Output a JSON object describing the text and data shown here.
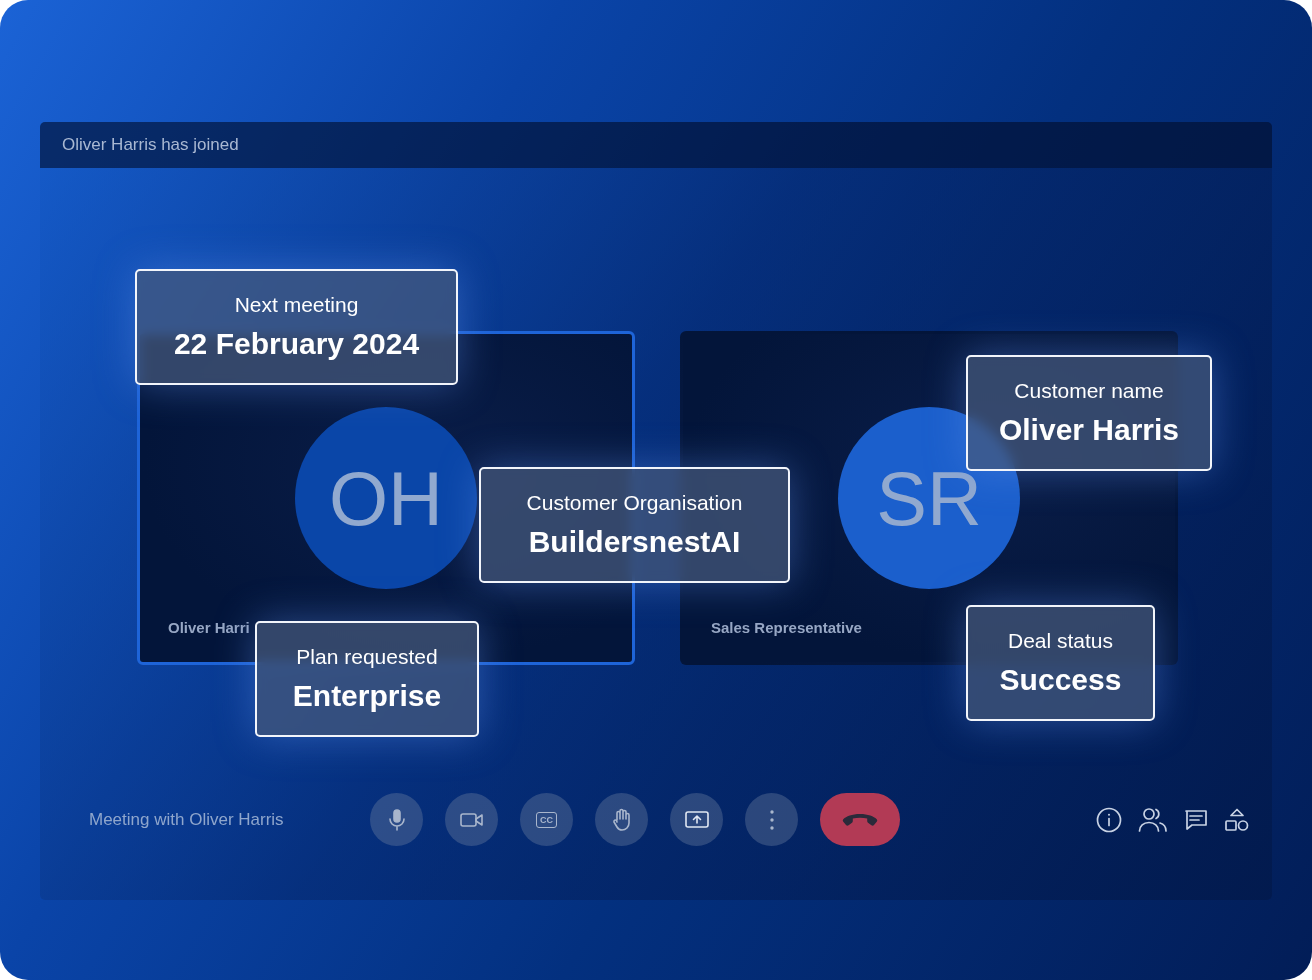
{
  "notification": "Oliver Harris has joined",
  "participants": [
    {
      "initials": "OH",
      "name": "Oliver Harri",
      "selected": true
    },
    {
      "initials": "SR",
      "name": "Sales Representative",
      "selected": false
    }
  ],
  "info_cards": [
    {
      "label": "Next meeting",
      "value": "22 February 2024"
    },
    {
      "label": "Customer Organisation",
      "value": "BuildersnestAI"
    },
    {
      "label": "Plan requested",
      "value": "Enterprise"
    },
    {
      "label": "Customer name",
      "value": "Oliver Harris"
    },
    {
      "label": "Deal status",
      "value": "Success"
    }
  ],
  "meeting_title": "Meeting with Oliver Harris",
  "controls": [
    {
      "kind": "mic"
    },
    {
      "kind": "camera"
    },
    {
      "kind": "captions",
      "label": "CC"
    },
    {
      "kind": "hand"
    },
    {
      "kind": "present"
    },
    {
      "kind": "more"
    },
    {
      "kind": "hangup"
    }
  ],
  "side_icons": [
    {
      "kind": "info"
    },
    {
      "kind": "people"
    },
    {
      "kind": "chat"
    },
    {
      "kind": "activities"
    }
  ]
}
